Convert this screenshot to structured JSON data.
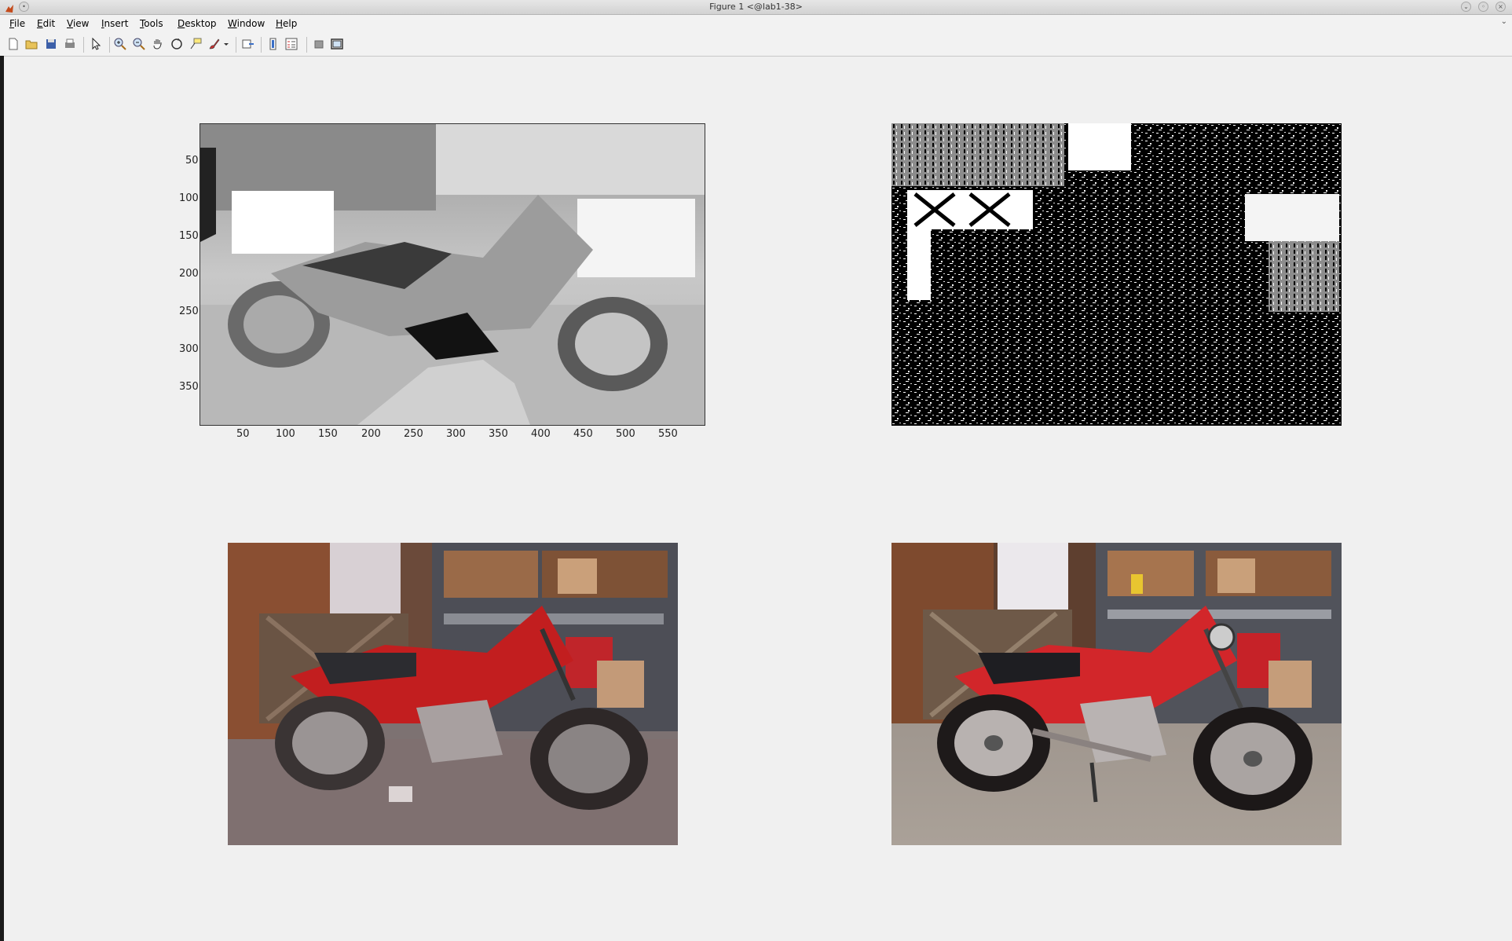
{
  "window": {
    "title": "Figure 1 <@lab1-38>"
  },
  "menubar": {
    "items": [
      {
        "key": "F",
        "rest": "ile"
      },
      {
        "key": "E",
        "rest": "dit"
      },
      {
        "key": "V",
        "rest": "iew"
      },
      {
        "key": "I",
        "rest": "nsert"
      },
      {
        "key": "T",
        "rest": "ools"
      },
      {
        "key": "D",
        "rest": "esktop"
      },
      {
        "key": "W",
        "rest": "indow"
      },
      {
        "key": "H",
        "rest": "elp"
      }
    ]
  },
  "toolbar": {
    "icons": [
      "new-figure-icon",
      "open-file-icon",
      "save-icon",
      "print-icon",
      "pointer-icon",
      "zoom-in-icon",
      "zoom-out-icon",
      "pan-hand-icon",
      "rotate-3d-icon",
      "data-cursor-icon",
      "brush-icon",
      "link-plot-icon",
      "colorbar-icon",
      "legend-icon",
      "hide-plot-tools-icon",
      "show-plot-tools-icon"
    ]
  },
  "axes1": {
    "yticks": [
      "50",
      "100",
      "150",
      "200",
      "250",
      "300",
      "350"
    ],
    "xticks": [
      "50",
      "100",
      "150",
      "200",
      "250",
      "300",
      "350",
      "400",
      "450",
      "500",
      "550"
    ]
  }
}
